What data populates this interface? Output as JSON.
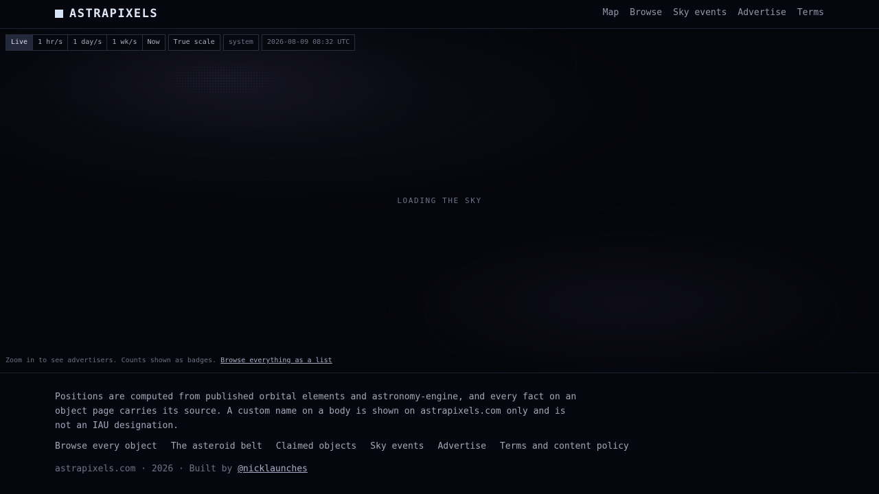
{
  "header": {
    "brand": "ASTRAPIXELS",
    "nav": [
      "Map",
      "Browse",
      "Sky events",
      "Advertise",
      "Terms"
    ]
  },
  "controls": {
    "speed": [
      "Live",
      "1 hr/s",
      "1 day/s",
      "1 wk/s",
      "Now"
    ],
    "active_speed": "Live",
    "scale": "True scale",
    "frame": "system",
    "datetime": "2026-08-09 08:32 UTC"
  },
  "map": {
    "loading": "LOADING THE SKY",
    "hint": "Zoom in to see advertisers. Counts shown as badges.",
    "hint_link": "Browse everything as a list"
  },
  "footer": {
    "about": "Positions are computed from published orbital elements and astronomy-engine, and every fact on an object page carries its source. A custom name on a body is shown on astrapixels.com only and is not an IAU designation.",
    "links": [
      "Browse every object",
      "The asteroid belt",
      "Claimed objects",
      "Sky events",
      "Advertise",
      "Terms and content policy"
    ],
    "credit_prefix": "astrapixels.com · 2026 · Built by",
    "credit_link": "@nicklaunches"
  },
  "colors": {
    "background": "#05050c",
    "accent": "#d7e3f6",
    "border": "#2a2d3c"
  }
}
